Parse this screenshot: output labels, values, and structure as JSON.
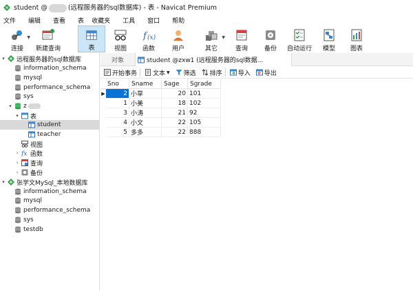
{
  "window": {
    "title_prefix": "student @",
    "title_suffix": "(远程服务器的sql数据库) - 表 - Navicat Premium"
  },
  "menubar": [
    "文件",
    "编辑",
    "查看",
    "表",
    "收藏夹",
    "工具",
    "窗口",
    "帮助"
  ],
  "toolbar": {
    "connect": "连接",
    "new_query": "新建查询",
    "table": "表",
    "view": "视图",
    "function": "函数",
    "user": "用户",
    "other": "其它",
    "query": "查询",
    "backup": "备份",
    "auto_run": "自动运行",
    "model": "模型",
    "chart": "图表"
  },
  "sidebar": {
    "conn1": "远程服务器的sql数据库",
    "conn1_dbs": [
      "information_schema",
      "mysql",
      "performance_schema",
      "sys"
    ],
    "db_open": "z",
    "tables_group": "表",
    "tables": [
      "student",
      "teacher"
    ],
    "views": "视图",
    "functions": "函数",
    "queries": "查询",
    "backups": "备份",
    "conn2": "张学文MySql_本地数据库",
    "conn2_dbs": [
      "information_schema",
      "mysql",
      "performance_schema",
      "sys",
      "testdb"
    ]
  },
  "tabs": {
    "objects": "对象",
    "active": "student @zxw1 (远程服务器的sql数据..."
  },
  "subtoolbar": {
    "begin_tx": "开始事务",
    "text": "文本",
    "filter": "筛选",
    "sort": "排序",
    "import": "导入",
    "export": "导出"
  },
  "grid": {
    "columns": [
      "Sno",
      "Sname",
      "Sage",
      "Sgrade"
    ],
    "rows": [
      [
        "2",
        "小草",
        "20",
        "101"
      ],
      [
        "1",
        "小美",
        "18",
        "102"
      ],
      [
        "3",
        "小涛",
        "21",
        "92"
      ],
      [
        "4",
        "小文",
        "22",
        "105"
      ],
      [
        "5",
        "多多",
        "22",
        "888"
      ]
    ]
  },
  "colors": {
    "selection": "#0a72d6",
    "active_tool": "#cde6f7",
    "tree_selected": "#d9d9d9"
  }
}
